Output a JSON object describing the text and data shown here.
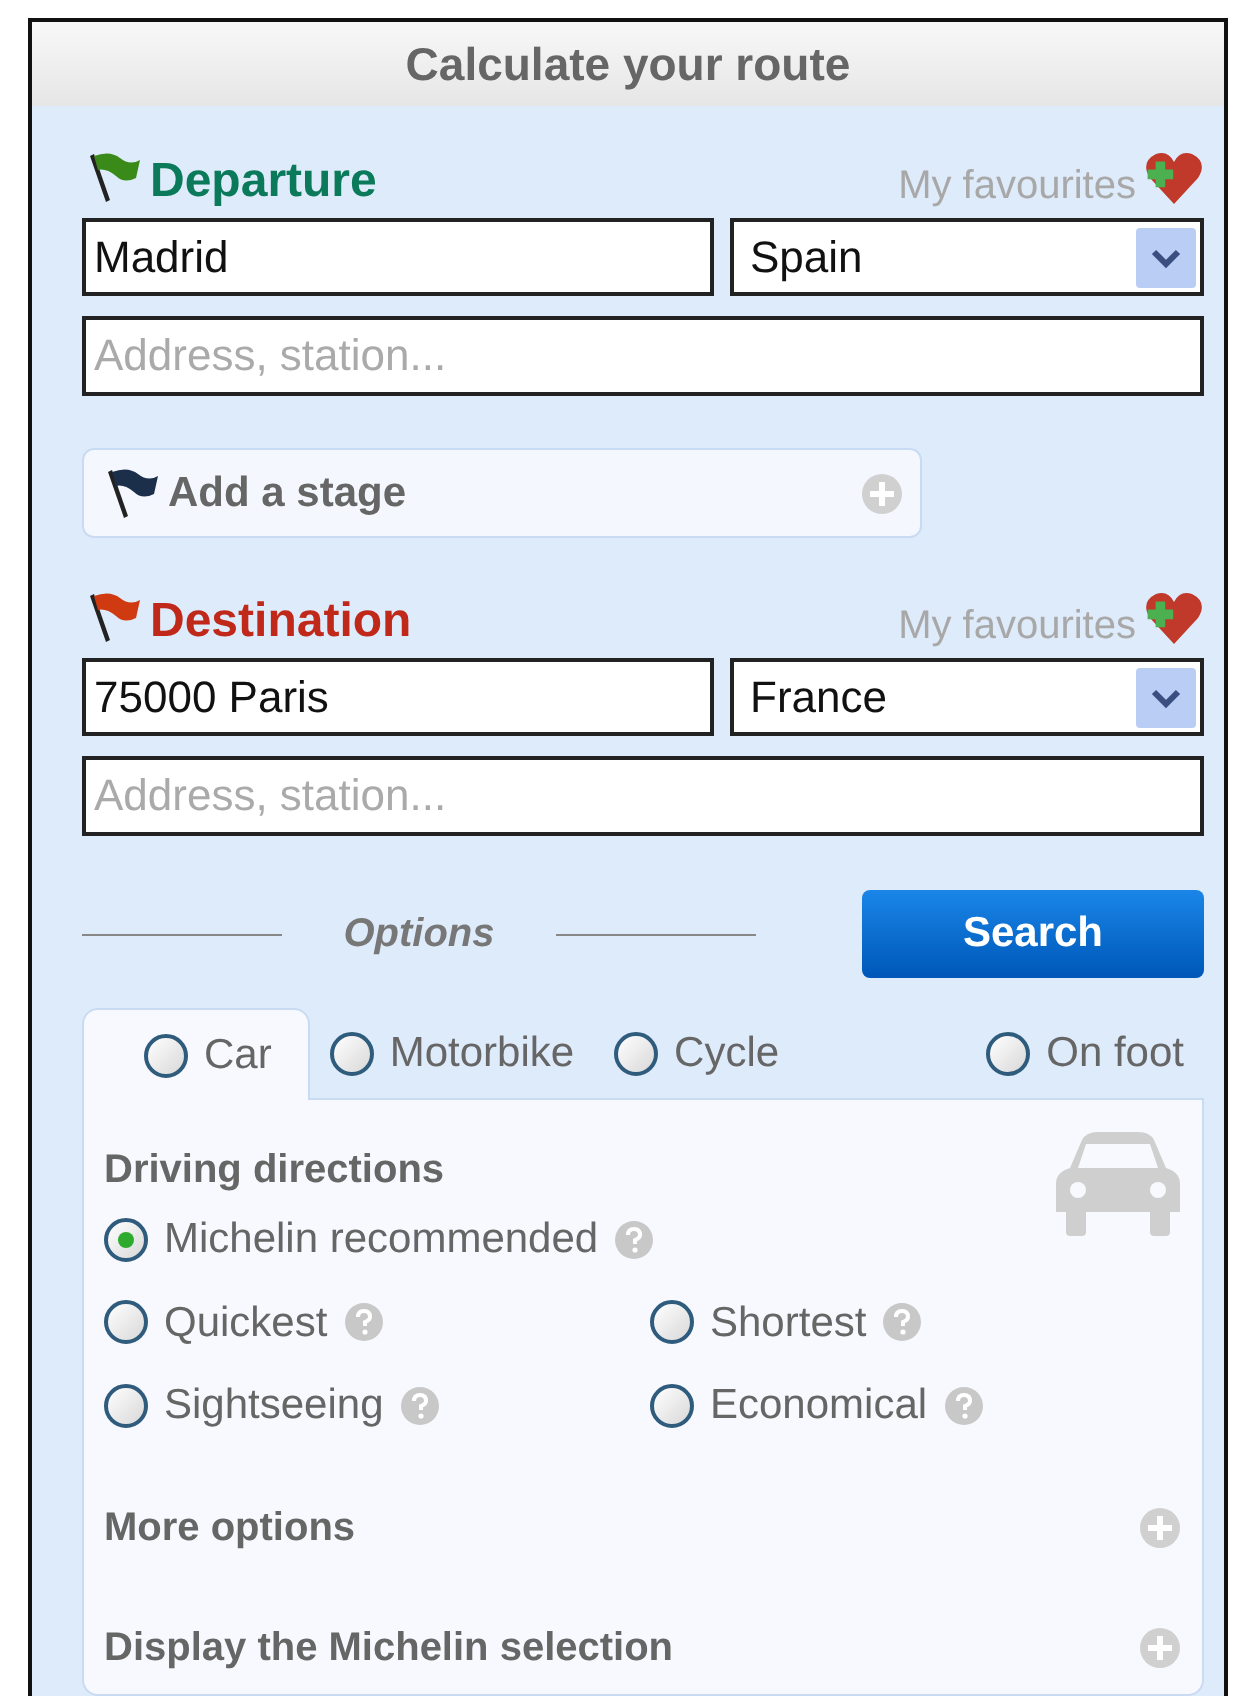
{
  "header": {
    "title": "Calculate your route"
  },
  "departure": {
    "label": "Departure",
    "favourites": "My favourites",
    "city": "Madrid",
    "country": "Spain",
    "address": {
      "placeholder": "Address, station..."
    }
  },
  "add_stage": {
    "label": "Add a stage"
  },
  "destination": {
    "label": "Destination",
    "favourites": "My favourites",
    "city": "75000 Paris",
    "country": "France",
    "address": {
      "placeholder": "Address, station..."
    }
  },
  "options": {
    "label": "Options"
  },
  "search_button": "Search",
  "modes": [
    {
      "label": "Car",
      "selected": true
    },
    {
      "label": "Motorbike",
      "selected": false
    },
    {
      "label": "Cycle",
      "selected": false
    },
    {
      "label": "On foot",
      "selected": false
    }
  ],
  "directions": {
    "title": "Driving directions",
    "choices": [
      {
        "label": "Michelin recommended",
        "selected": true
      },
      {
        "label": "Quickest",
        "selected": false
      },
      {
        "label": "Shortest",
        "selected": false
      },
      {
        "label": "Sightseeing",
        "selected": false
      },
      {
        "label": "Economical",
        "selected": false
      }
    ]
  },
  "expanders": [
    {
      "label": "More options",
      "expanded": false
    },
    {
      "label": "Display the Michelin selection",
      "expanded": false
    }
  ]
}
